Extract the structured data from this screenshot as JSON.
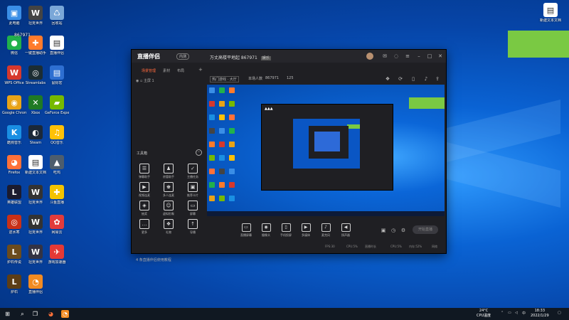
{
  "desktop": {
    "icons": [
      {
        "label": "此电脑",
        "glyph": "▣",
        "color": "#3a8ee6"
      },
      {
        "label": "坦克世界",
        "glyph": "W",
        "color": "#444"
      },
      {
        "label": "回收站",
        "glyph": "♺",
        "color": "#7aa7d8"
      },
      {
        "label": "微信",
        "glyph": "●",
        "color": "#21b14b"
      },
      {
        "label": "一键直播助手",
        "glyph": "✚",
        "color": "#ff7b2c"
      },
      {
        "label": "直播伴侣",
        "glyph": "▤",
        "color": "#ffffff"
      },
      {
        "label": "WPS Office",
        "glyph": "W",
        "color": "#d6382d"
      },
      {
        "label": "Streamlabs",
        "glyph": "◎",
        "color": "#1c2d33"
      },
      {
        "label": "鼠标宏",
        "glyph": "▤",
        "color": "#2e6fd1"
      },
      {
        "label": "Google Chrome",
        "glyph": "◉",
        "color": "#e8a317"
      },
      {
        "label": "Xbox",
        "glyph": "✕",
        "color": "#1f7a24"
      },
      {
        "label": "GeForce Experience",
        "glyph": "▰",
        "color": "#76b900"
      },
      {
        "label": "酷狗音乐",
        "glyph": "K",
        "color": "#1a8fe3"
      },
      {
        "label": "Steam",
        "glyph": "◐",
        "color": "#1b2838"
      },
      {
        "label": "QQ音乐",
        "glyph": "♫",
        "color": "#ffc107"
      },
      {
        "label": "Firefox",
        "glyph": "◕",
        "color": "#ff7139"
      },
      {
        "label": "新建文本文档",
        "glyph": "▤",
        "color": "#ffffff"
      },
      {
        "label": "吃鸡",
        "glyph": "▲",
        "color": "#4d5d6d"
      },
      {
        "label": "英雄联盟",
        "glyph": "L",
        "color": "#1b1b2f"
      },
      {
        "label": "坦克世界",
        "glyph": "W",
        "color": "#333"
      },
      {
        "label": "斗鱼直播",
        "glyph": "✚",
        "color": "#f3c300"
      },
      {
        "label": "逆水寒",
        "glyph": "◎",
        "color": "#c83018"
      },
      {
        "label": "坦克世界",
        "glyph": "W",
        "color": "#333"
      },
      {
        "label": "网易云",
        "glyph": "✿",
        "color": "#e23b3b"
      },
      {
        "label": "炉石传说",
        "glyph": "L",
        "color": "#6b4b1d"
      },
      {
        "label": "坦克世界",
        "glyph": "W",
        "color": "#334"
      },
      {
        "label": "游戏加速器",
        "glyph": "✈",
        "color": "#e53935"
      },
      {
        "label": "炉石",
        "glyph": "L",
        "color": "#5c3d16"
      },
      {
        "label": "直播伴侣",
        "glyph": "◔",
        "color": "#f28b22"
      }
    ],
    "top_left_text": "867971",
    "top_right_file": "新建文本文档"
  },
  "app": {
    "logo": "直播伴侣",
    "version": "内测",
    "room_title": "万丈高楼平地起 867971",
    "room_tag": "娱乐",
    "sidebar_tabs": [
      "场景管理",
      "素材",
      "布局",
      "新增"
    ],
    "scene_label": "主屏 1",
    "tools_title": "工具箱",
    "tools": [
      {
        "label": "弹幕助手",
        "icon": "☰"
      },
      {
        "label": "房管助手",
        "icon": "♟"
      },
      {
        "label": "主播任务",
        "icon": "✓"
      },
      {
        "label": "视频连麦",
        "icon": "▶"
      },
      {
        "label": "多人连麦",
        "icon": "♚"
      },
      {
        "label": "推荐卡片",
        "icon": "▣"
      },
      {
        "label": "抽奖",
        "icon": "◈"
      },
      {
        "label": "虚拟形象",
        "icon": "☺"
      },
      {
        "label": "屏幕",
        "icon": "▭"
      },
      {
        "label": "更多",
        "icon": "…"
      },
      {
        "label": "礼物",
        "icon": "❖"
      },
      {
        "label": "导播",
        "icon": "↑"
      }
    ],
    "sidebar_bottom": "4 条直播伴侣使用教程",
    "preview_tags": [
      "热门游戏 · 大厅",
      "本场人数",
      "867971",
      "125"
    ],
    "bottom_controls": [
      {
        "label": "直播屏幕",
        "icon": "▭"
      },
      {
        "label": "摄像头",
        "icon": "◉"
      },
      {
        "label": "手机投屏",
        "icon": "▯"
      },
      {
        "label": "多媒体",
        "icon": "▶"
      },
      {
        "label": "麦克风",
        "icon": "♪"
      },
      {
        "label": "扬声器",
        "icon": "◀"
      }
    ],
    "go_live": "开始直播",
    "status_items": [
      "FPS:30",
      "CPU:5%",
      "直播时长",
      "CPU:5%",
      "内存:52%",
      "网络"
    ]
  },
  "taskbar": {
    "weather": "24°C",
    "weather_sub": "CPU温度",
    "time": "18:33",
    "date": "2022/1/29"
  },
  "colors": {
    "accent_green": "#7ac943",
    "accent_orange": "#ff6a3d"
  }
}
